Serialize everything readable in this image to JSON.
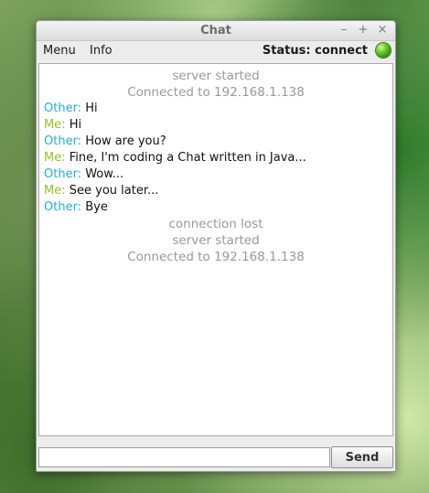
{
  "window": {
    "title": "Chat",
    "controls": {
      "minimize": "–",
      "maximize": "+",
      "close": "×"
    }
  },
  "menubar": {
    "menu_label": "Menu",
    "info_label": "Info",
    "status_text": "Status: connect",
    "status_icon": "green-status-icon",
    "status_color": "#5ec223"
  },
  "colors": {
    "other": "#1fb3d6",
    "me": "#93c32a",
    "system": "#9a9a9a"
  },
  "messages": [
    {
      "type": "system",
      "text": "server started"
    },
    {
      "type": "system",
      "text": "Connected to 192.168.1.138"
    },
    {
      "type": "chat",
      "sender": "Other:",
      "text": "Hi"
    },
    {
      "type": "chat",
      "sender": "Me:",
      "text": "Hi"
    },
    {
      "type": "chat",
      "sender": "Other:",
      "text": "How are you?"
    },
    {
      "type": "chat",
      "sender": "Me:",
      "text": "Fine, I'm coding a Chat written in Java..."
    },
    {
      "type": "chat",
      "sender": "Other:",
      "text": "Wow..."
    },
    {
      "type": "chat",
      "sender": "Me:",
      "text": "See you later..."
    },
    {
      "type": "chat",
      "sender": "Other:",
      "text": "Bye"
    },
    {
      "type": "system",
      "text": "connection lost"
    },
    {
      "type": "system",
      "text": "server started"
    },
    {
      "type": "system",
      "text": "Connected to 192.168.1.138"
    }
  ],
  "input": {
    "value": "",
    "placeholder": ""
  },
  "send_label": "Send"
}
